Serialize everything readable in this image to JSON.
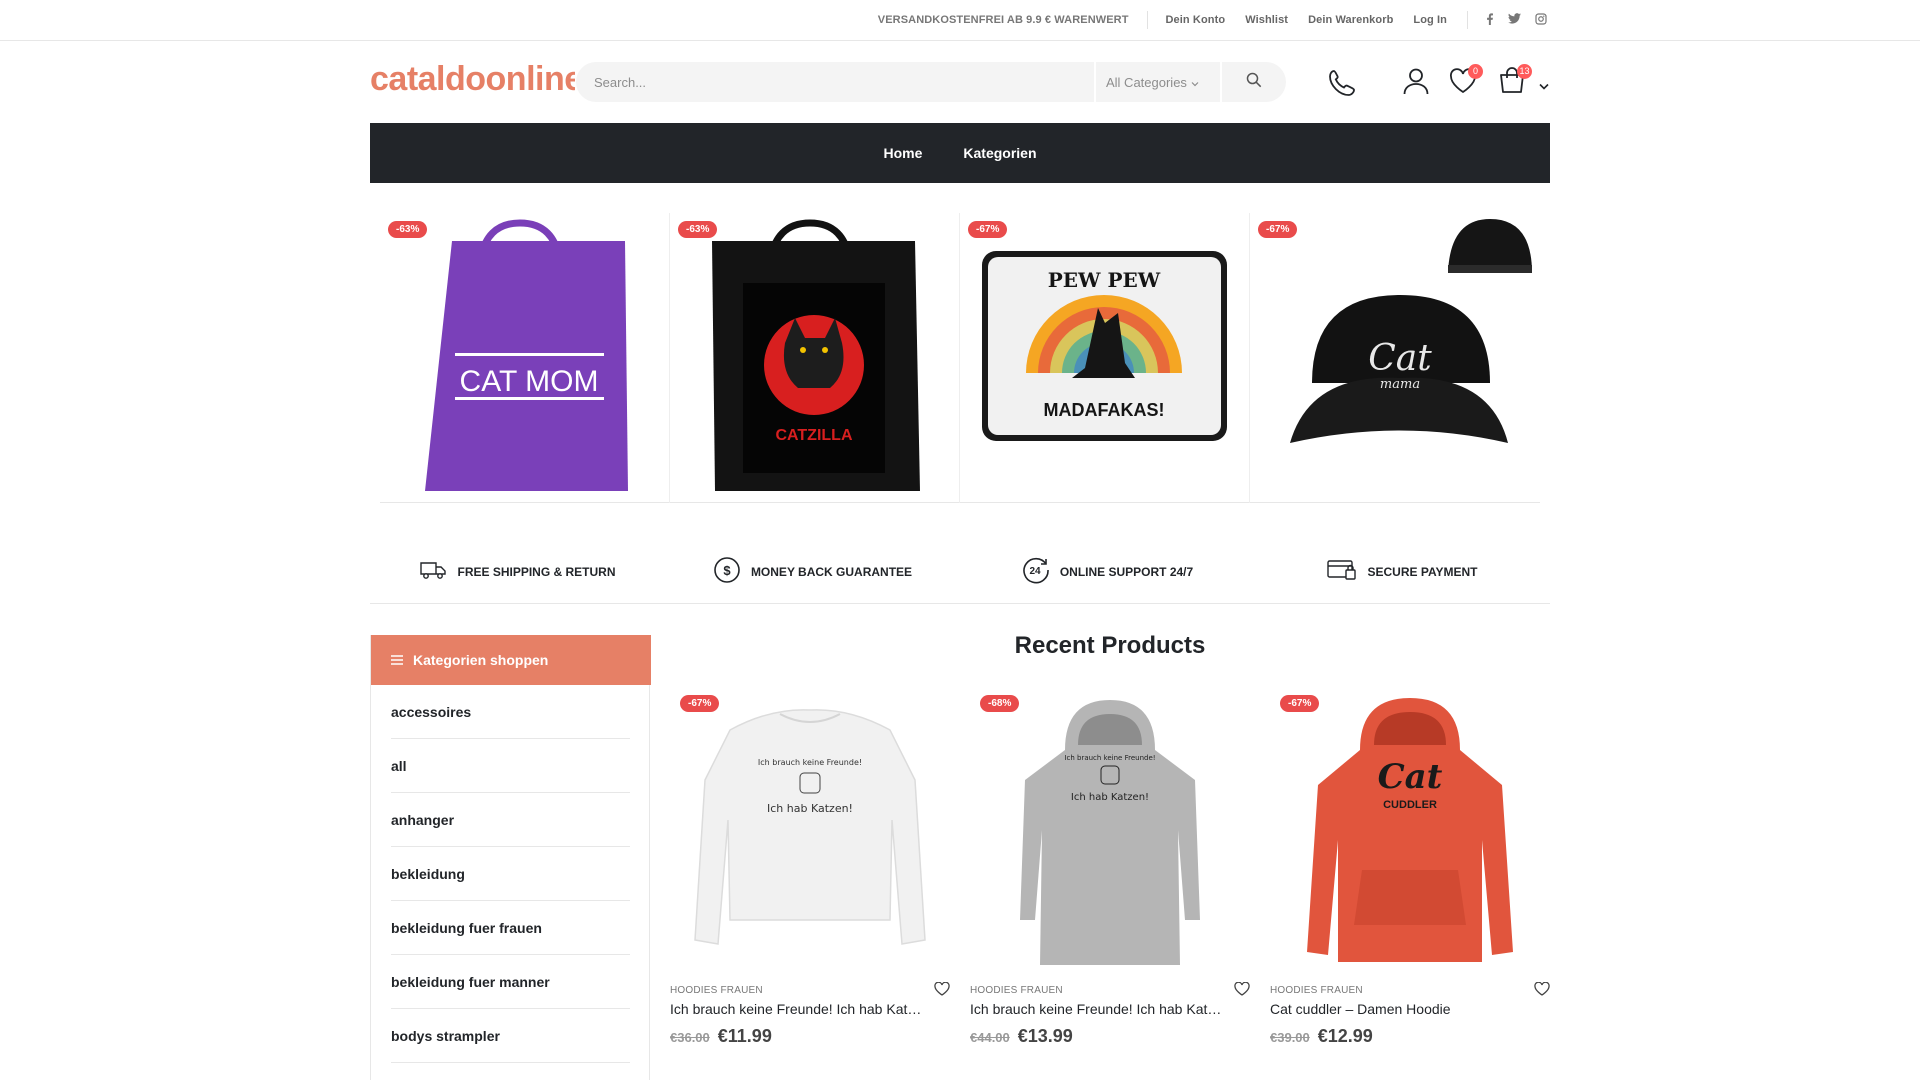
{
  "topbar": {
    "shipping": "VERSANDKOSTENFREI AB 9.9 € WARENWERT",
    "links": [
      "Dein Konto",
      "Wishlist",
      "Dein Warenkorb",
      "Log In"
    ],
    "social": [
      "facebook-icon",
      "twitter-icon",
      "instagram-icon"
    ]
  },
  "header": {
    "logo": "cataldoonline",
    "search_placeholder": "Search...",
    "category_select": "All Categories",
    "wishlist_count": "0",
    "cart_count": "13"
  },
  "nav": {
    "items": [
      "Home",
      "Kategorien"
    ]
  },
  "banner": {
    "items": [
      {
        "discount": "-63%",
        "print": "CAT MOM"
      },
      {
        "discount": "-63%",
        "print": "CATZILLA"
      },
      {
        "discount": "-67%",
        "print_top": "PEW PEW",
        "print_bottom": "MADAFAKAS!"
      },
      {
        "discount": "-67%",
        "print": "Cat",
        "print_sub": "mama"
      }
    ]
  },
  "features": [
    "FREE SHIPPING & RETURN",
    "MONEY BACK GUARANTEE",
    "ONLINE SUPPORT 24/7",
    "SECURE PAYMENT"
  ],
  "sidebar": {
    "title": "Kategorien shoppen",
    "items": [
      "accessoires",
      "all",
      "anhanger",
      "bekleidung",
      "bekleidung fuer frauen",
      "bekleidung fuer manner",
      "bodys strampler"
    ]
  },
  "recent": {
    "title": "Recent Products",
    "products": [
      {
        "discount": "-67%",
        "category": "HOODIES FRAUEN",
        "name": "Ich brauch keine Freunde! Ich hab Katzen!",
        "old_price": "€36.00",
        "price": "€11.99",
        "print_top": "Ich brauch keine Freunde!",
        "print_bottom": "Ich hab Katzen!"
      },
      {
        "discount": "-68%",
        "category": "HOODIES FRAUEN",
        "name": "Ich brauch keine Freunde! Ich hab Katzen!",
        "old_price": "€44.00",
        "price": "€13.99",
        "print_top": "Ich brauch keine Freunde!",
        "print_bottom": "Ich hab Katzen!"
      },
      {
        "discount": "-67%",
        "category": "HOODIES FRAUEN",
        "name": "Cat cuddler – Damen Hoodie",
        "old_price": "€39.00",
        "price": "€12.99",
        "print_top": "Cat",
        "print_bottom": "CUDDLER"
      }
    ]
  },
  "colors": {
    "accent": "#e68066",
    "dark": "#222529",
    "sale": "#e94b4b"
  }
}
